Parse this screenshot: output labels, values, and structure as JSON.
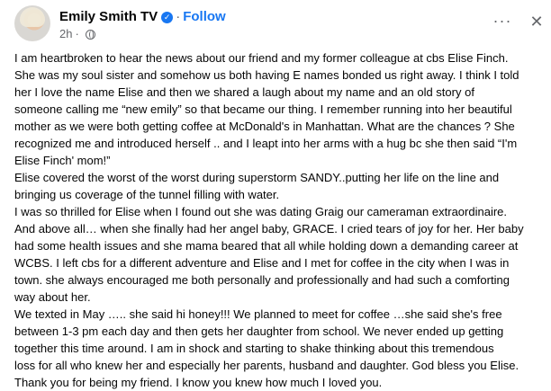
{
  "post": {
    "author": "Emily Smith TV",
    "follow_label": "Follow",
    "timestamp": "2h",
    "separator": "·",
    "more_icon_glyph": "···",
    "close_icon_glyph": "✕",
    "lines": [
      "I am heartbroken to hear the news about our friend and my former colleague at cbs Elise Finch.",
      "She was my soul sister and somehow us both having E names bonded us right away. I think I told",
      "her I love the name Elise and then we shared a laugh about my name and an old story of",
      "someone calling me “new emily” so that became our thing. I remember running into her beautiful",
      "mother as we were both getting coffee at McDonald's in Manhattan. What are the chances ? She",
      "recognized me and introduced herself .. and I leapt into her arms with a hug bc she then said “I'm",
      "Elise Finch' mom!”",
      "Elise covered the worst of the worst during superstorm  SANDY..putting her life on the line and",
      "bringing us coverage of the tunnel filling with water.",
      "I was so thrilled for Elise when I found out she was dating Graig our cameraman extraordinaire.",
      "And above all… when she finally had her angel baby, GRACE. I cried tears of joy for her. Her baby",
      "had some health issues and she mama beared that all while holding down a demanding career at",
      "WCBS. I left cbs for a different adventure and Elise and I met for coffee in the city when I was in",
      "town.  she always encouraged me both personally and professionally and had such a comforting",
      "way about her.",
      "We texted in May ….. she said hi honey!!! We planned to meet for coffee …she said she's free",
      "between 1-3 pm each day and then gets her daughter from school. We never ended up getting",
      "together this time around. I am in shock and starting to shake thinking about this tremendous",
      "loss for all who knew her and especially her parents, husband and daughter. God bless you Elise.",
      "Thank you for being my friend. I know you knew how much I loved you."
    ]
  },
  "icons": {
    "verified": "verified-badge-icon",
    "privacy": "globe-icon",
    "more": "more-options-icon",
    "close": "close-icon"
  },
  "colors": {
    "brand_blue": "#1877f2",
    "text_primary": "#050505",
    "text_secondary": "#65676b",
    "background": "#ffffff"
  }
}
